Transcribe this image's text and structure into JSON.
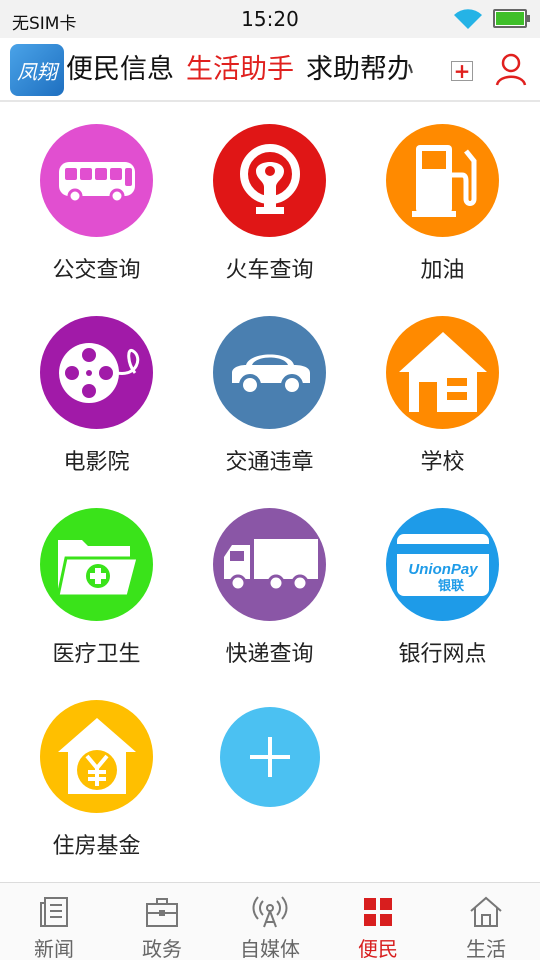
{
  "status_bar": {
    "carrier": "无SIM卡",
    "time": "15:20"
  },
  "header": {
    "logo_text": "凤翔",
    "tabs": [
      {
        "label": "便民信息",
        "active": false
      },
      {
        "label": "生活助手",
        "active": true
      },
      {
        "label": "求助帮办",
        "active": false
      }
    ],
    "accent_color": "#e0201e"
  },
  "services": [
    {
      "label": "公交查询",
      "icon": "bus-icon",
      "color": "#e14fd0"
    },
    {
      "label": "火车查询",
      "icon": "railway-icon",
      "color": "#e01616"
    },
    {
      "label": "加油",
      "icon": "gas-pump-icon",
      "color": "#ff8a00"
    },
    {
      "label": "电影院",
      "icon": "film-reel-icon",
      "color": "#a11aa8"
    },
    {
      "label": "交通违章",
      "icon": "car-icon",
      "color": "#4a7fb0"
    },
    {
      "label": "学校",
      "icon": "school-house-icon",
      "color": "#ff8a00"
    },
    {
      "label": "医疗卫生",
      "icon": "medical-folder-icon",
      "color": "#3ae31a"
    },
    {
      "label": "快递查询",
      "icon": "truck-icon",
      "color": "#8a56a6"
    },
    {
      "label": "银行网点",
      "icon": "unionpay-card-icon",
      "color": "#1e9be8"
    },
    {
      "label": "住房基金",
      "icon": "housing-fund-icon",
      "color": "#ffbf00"
    }
  ],
  "add_button": {
    "icon": "plus-icon",
    "color": "#4bc1f2"
  },
  "unionpay": {
    "line1": "UnionPay",
    "line2": "银联"
  },
  "bottom_nav": [
    {
      "label": "新闻",
      "icon": "news-icon",
      "active": false
    },
    {
      "label": "政务",
      "icon": "briefcase-icon",
      "active": false
    },
    {
      "label": "自媒体",
      "icon": "broadcast-icon",
      "active": false
    },
    {
      "label": "便民",
      "icon": "grid-icon",
      "active": true
    },
    {
      "label": "生活",
      "icon": "home-icon",
      "active": false
    }
  ],
  "active_color": "#d81e1e"
}
